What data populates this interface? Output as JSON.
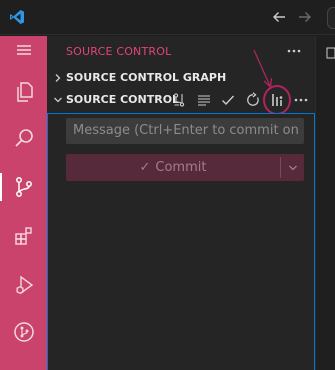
{
  "sidebar": {
    "title": "SOURCE CONTROL",
    "sections": {
      "graph_label": "SOURCE CONTROL GRAPH",
      "source_control_label": "SOURCE CONTROL"
    }
  },
  "commit": {
    "message_placeholder": "Message (Ctrl+Enter to commit on ...",
    "button_label": "Commit"
  },
  "activity_bar": {
    "items": [
      "explorer",
      "search",
      "source-control",
      "extensions",
      "run-and-debug",
      "git-graph"
    ],
    "active": "source-control"
  },
  "colors": {
    "activity_bar": "#c9436c",
    "title_accent": "#e0457b",
    "focus_border": "#0078d4",
    "commit_button": "#562a3a",
    "annotation": "#b0245e"
  },
  "icons": {
    "title_bar": [
      "vscode-logo-icon",
      "arrow-left-icon",
      "arrow-right-icon"
    ],
    "source_control_actions": [
      "graph-branch-icon",
      "list-icon",
      "check-icon",
      "refresh-icon",
      "highlighted-action-icon",
      "more-icon"
    ]
  }
}
